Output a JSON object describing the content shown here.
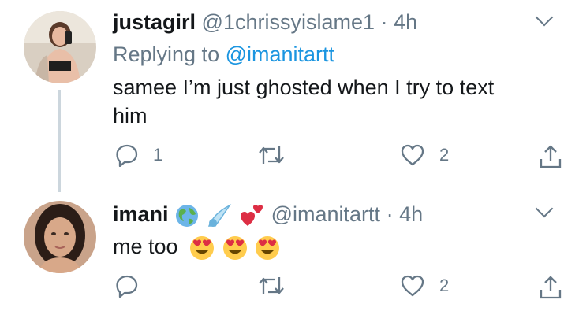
{
  "tweets": [
    {
      "name": "justagirl",
      "handle": "@1chrissyislame1",
      "separator": "·",
      "time": "4h",
      "replying_prefix": "Replying to",
      "replying_handle": "@imanitartt",
      "text_line1": "samee I’m just ghosted when I try to text",
      "text_line2": "him",
      "reply_count": "1",
      "like_count": "2"
    },
    {
      "name": "imani",
      "handle": "@imanitartt",
      "separator": "·",
      "time": "4h",
      "text": "me too",
      "like_count": "2"
    }
  ],
  "icons": {
    "reply": "reply-icon",
    "retweet": "retweet-icon",
    "like": "heart-icon",
    "share": "share-icon",
    "caret": "chevron-down-icon",
    "name_emojis": [
      "globe-emoji",
      "comet-emoji",
      "two-hearts-emoji"
    ],
    "text_emojis": [
      "heart-eyes-emoji",
      "heart-eyes-emoji",
      "heart-eyes-emoji"
    ]
  },
  "colors": {
    "text": "#14171a",
    "secondary": "#657786",
    "link": "#1b95e0",
    "thread_line": "#ccd6dd"
  }
}
